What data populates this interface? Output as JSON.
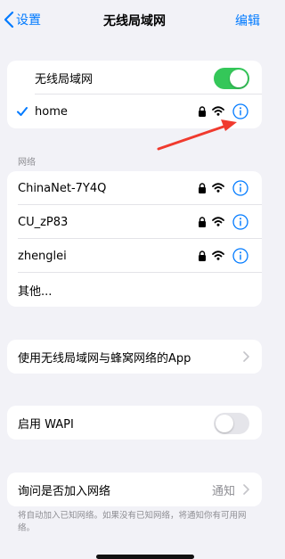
{
  "nav": {
    "back_label": "设置",
    "title": "无线局域网",
    "edit_label": "编辑"
  },
  "wlan_card": {
    "toggle_label": "无线局域网",
    "toggle_on": true,
    "connected_network": "home"
  },
  "networks_header": "网络",
  "networks": [
    {
      "name": "ChinaNet-7Y4Q"
    },
    {
      "name": "CU_zP83"
    },
    {
      "name": "zhenglei"
    }
  ],
  "other_label": "其他...",
  "apps_row": {
    "label": "使用无线局域网与蜂窝网络的App"
  },
  "wapi_row": {
    "label": "启用 WAPI",
    "toggle_on": false
  },
  "ask_join_row": {
    "label": "询问是否加入网络",
    "value": "通知",
    "footer": "将自动加入已知网络。如果没有已知网络，将通知你有可用网络。"
  },
  "colors": {
    "accent": "#007aff",
    "toggle_on": "#34c759",
    "annotation_arrow": "#f03a2e"
  }
}
